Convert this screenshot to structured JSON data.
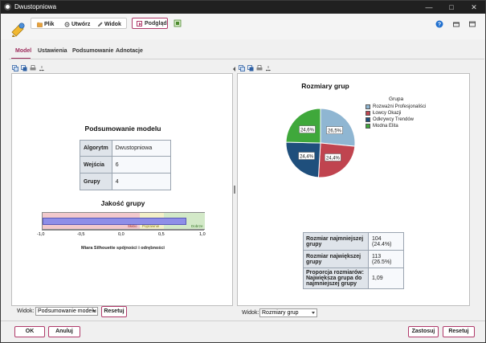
{
  "window": {
    "title": "Dwustopniowa"
  },
  "menu": {
    "file": "Plik",
    "create": "Utwórz",
    "view": "Widok",
    "preview": "Podgląd"
  },
  "tabs": [
    {
      "label": "Model"
    },
    {
      "label": "Ustawienia"
    },
    {
      "label": "Podsumowanie"
    },
    {
      "label": "Adnotacje"
    }
  ],
  "left": {
    "heading": "Podsumowanie modelu",
    "summary": [
      {
        "label": "Algorytm",
        "value": "Dwustopniowa"
      },
      {
        "label": "Wejścia",
        "value": "6"
      },
      {
        "label": "Grupy",
        "value": "4"
      }
    ],
    "quality": {
      "heading": "Jakość grupy",
      "silhouette": 0.77,
      "zones": [
        "Słabo",
        "Poprawnie",
        "Dobrze"
      ],
      "ticks": [
        "-1,0",
        "-0,5",
        "0,0",
        "0,5",
        "1,0"
      ],
      "axis_label": "Miara Silhouette spójności i odrębności"
    },
    "view_label": "Widok:",
    "view_value": "Podsumowanie modelu",
    "reset": "Resetuj"
  },
  "right": {
    "heading": "Rozmiary grup",
    "legend_title": "Grupa",
    "chart_data": {
      "type": "pie",
      "title": "Rozmiary grup",
      "legend_title": "Grupa",
      "slices": [
        {
          "name": "Rozważni Profesjonaliści",
          "value": 26.5,
          "label": "26,5%",
          "color": "#8fb6d2"
        },
        {
          "name": "Łowcy Okazji",
          "value": 24.4,
          "label": "24,4%",
          "color": "#c0444f"
        },
        {
          "name": "Odkrywcy Trendów",
          "value": 24.4,
          "label": "24,4%",
          "color": "#1f4f7c"
        },
        {
          "name": "Modna Elita",
          "value": 24.6,
          "label": "24,6%",
          "color": "#3fa83b"
        }
      ]
    },
    "stats": [
      {
        "label": "Rozmiar najmniejszej grupy",
        "value": "104 (24.4%)"
      },
      {
        "label": "Rozmiar największej grupy",
        "value": "113 (26.5%)"
      },
      {
        "label": "Proporcja rozmiarów: Największa grupa do najmniejszej grupy",
        "value": "1,09"
      }
    ],
    "view_label": "Widok:",
    "view_value": "Rozmiary grup"
  },
  "footer": {
    "ok": "OK",
    "cancel": "Anuluj",
    "apply": "Zastosuj",
    "reset": "Resetuj"
  }
}
